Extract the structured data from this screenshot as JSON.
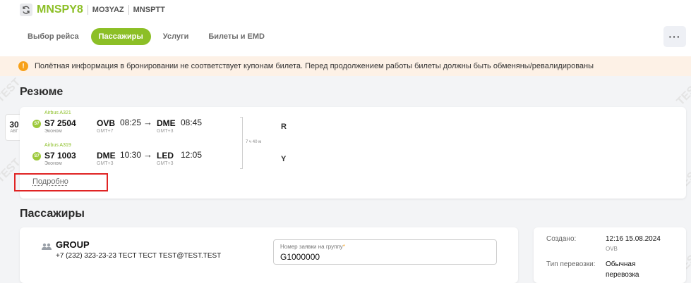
{
  "header": {
    "pnr_main": "MNSPY8",
    "pnr_codes": [
      "MO3YAZ",
      "MNSPTT"
    ],
    "sync_icon": "sync-icon",
    "accent_color": "#8cbf26"
  },
  "tabs": [
    {
      "label": "Выбор рейса",
      "active": false
    },
    {
      "label": "Пассажиры",
      "active": true
    },
    {
      "label": "Услуги",
      "active": false
    },
    {
      "label": "Билеты и EMD",
      "active": false
    }
  ],
  "more_button": "···",
  "alert": {
    "icon": "warning-icon",
    "text": "Полётная информация в бронировании не соответствует купонам билета. Перед продолжением работы билеты должны быть обменяны/ревалидированы"
  },
  "resume": {
    "title": "Резюме",
    "date_day": "30",
    "date_month": "АВГ",
    "flights": [
      {
        "aircraft": "Airbus A321",
        "airline_logo": "S7",
        "number": "S7  2504",
        "class": "Эконом",
        "from": "OVB",
        "dep_time": "08:25",
        "dep_gmt": "GMT+7",
        "to": "DME",
        "arr_time": "08:45",
        "arr_gmt": "GMT+3",
        "fare": "R"
      },
      {
        "aircraft": "Airbus A319",
        "airline_logo": "S7",
        "number": "S7  1003",
        "class": "Эконом",
        "from": "DME",
        "dep_time": "10:30",
        "dep_gmt": "GMT+3",
        "to": "LED",
        "arr_time": "12:05",
        "arr_gmt": "GMT+3",
        "fare": "Y"
      }
    ],
    "duration": "7 ч 40 м",
    "details_link": "Подробно"
  },
  "passengers": {
    "title": "Пассажиры",
    "group_name": "GROUP",
    "contact": "+7 (232) 323-23-23 ТЕСТ ТЕСТ TEST@TEST.TEST",
    "request_label": "Номер заявки на группу",
    "request_required": "*",
    "request_value": "G1000000"
  },
  "info": {
    "created_label": "Создано:",
    "created_value": "12:16 15.08.2024",
    "created_city": "OVB",
    "transport_label": "Тип перевозки:",
    "transport_value_1": "Обычная",
    "transport_value_2": "перевозка"
  },
  "watermark": "TEST"
}
